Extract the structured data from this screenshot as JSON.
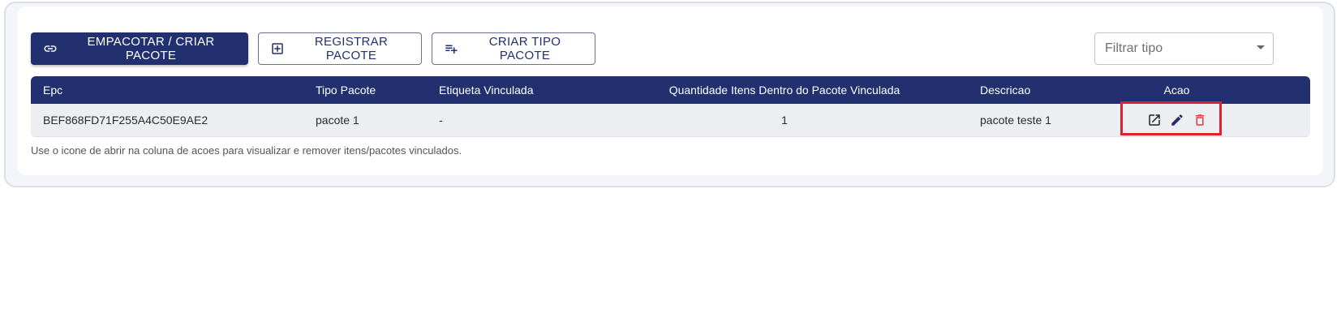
{
  "toolbar": {
    "pack_label": "EMPACOTAR / CRIAR PACOTE",
    "register_label": "REGISTRAR PACOTE",
    "create_type_label": "CRIAR TIPO PACOTE",
    "pack_icon": "link-icon",
    "register_icon": "add-box-icon",
    "create_type_icon": "playlist-add-icon"
  },
  "filter": {
    "placeholder": "Filtrar tipo"
  },
  "table": {
    "columns": [
      "Epc",
      "Tipo Pacote",
      "Etiqueta Vinculada",
      "Quantidade Itens Dentro do Pacote Vinculada",
      "Descricao",
      "Acao"
    ],
    "rows": [
      {
        "epc": "BEF868FD71F255A4C50E9AE2",
        "tipo": "pacote 1",
        "etiqueta": "-",
        "quantidade": "1",
        "descricao": "pacote teste 1",
        "actions": [
          "open-in-new-icon",
          "edit-pencil-icon",
          "delete-trash-icon"
        ]
      }
    ]
  },
  "hint": "Use o icone de abrir na coluna de acoes para visualizar e remover itens/pacotes vinculados.",
  "colors": {
    "primary": "#223070",
    "delete": "#e53935",
    "highlight": "#e0202a"
  }
}
